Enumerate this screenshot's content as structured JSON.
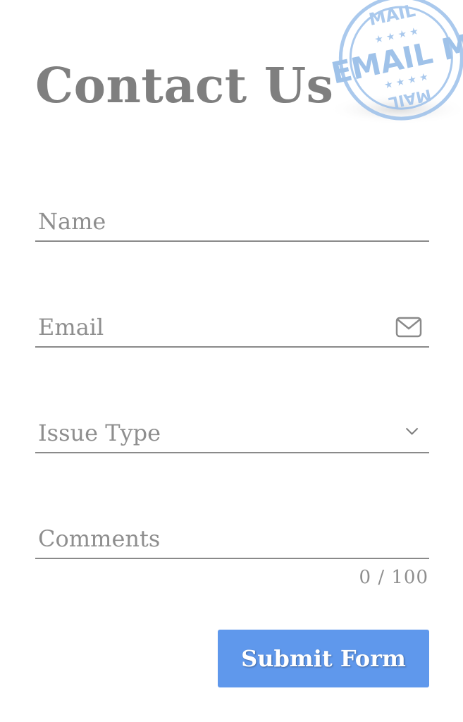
{
  "page": {
    "title": "Contact Us"
  },
  "stamp": {
    "top_text": "MAIL",
    "center_text": "EMAIL M",
    "bottom_text": "MAIL",
    "color": "#8fb8e6"
  },
  "form": {
    "name": {
      "placeholder": "Name",
      "value": ""
    },
    "email": {
      "placeholder": "Email",
      "value": "",
      "icon": "envelope-icon"
    },
    "issue_type": {
      "placeholder": "Issue Type",
      "icon": "chevron-down-icon"
    },
    "comments": {
      "placeholder": "Comments",
      "value": "",
      "counter": "0 / 100"
    },
    "submit_label": "Submit Form"
  },
  "colors": {
    "title": "#7f7f7f",
    "placeholder": "#8e8e8e",
    "underline": "#8a8a8a",
    "button": "#5f98ec",
    "button_text": "#ffffff"
  }
}
